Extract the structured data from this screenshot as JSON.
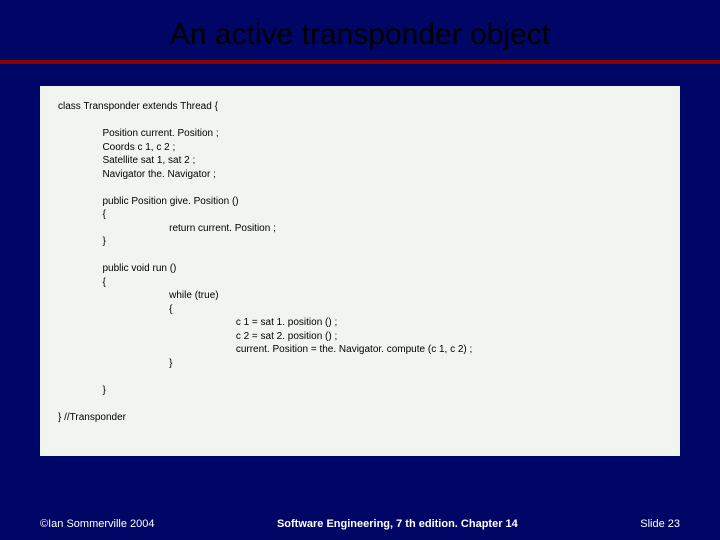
{
  "title": "An active transponder object",
  "code": "class Transponder extends Thread {\n\n                Position current. Position ;\n                Coords c 1, c 2 ;\n                Satellite sat 1, sat 2 ;\n                Navigator the. Navigator ;\n\n                public Position give. Position ()\n                {\n                                        return current. Position ;\n                }\n\n                public void run ()\n                {\n                                        while (true)\n                                        {\n                                                                c 1 = sat 1. position () ;\n                                                                c 2 = sat 2. position () ;\n                                                                current. Position = the. Navigator. compute (c 1, c 2) ;\n                                        }\n\n                }\n\n} //Transponder",
  "footer": {
    "left": "©Ian Sommerville 2004",
    "center": "Software Engineering, 7 th edition. Chapter 14",
    "right": "Slide 23"
  }
}
